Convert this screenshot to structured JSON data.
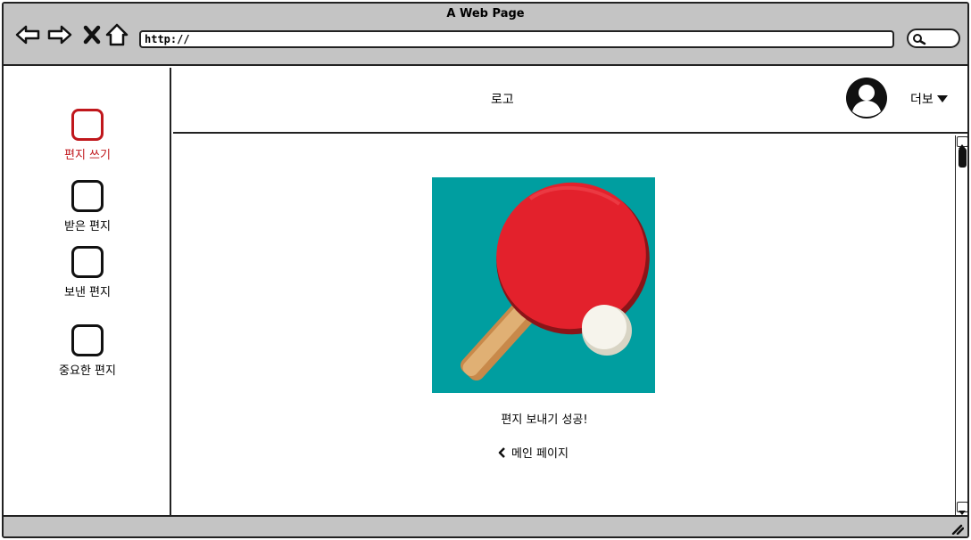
{
  "window": {
    "title": "A Web Page"
  },
  "toolbar": {
    "url": "http://",
    "back_icon": "back-arrow-icon",
    "forward_icon": "forward-arrow-icon",
    "close_icon": "close-x-icon",
    "home_icon": "home-icon",
    "search_icon": "search-icon"
  },
  "sidebar": {
    "items": [
      {
        "label": "편지 쓰기",
        "active": true
      },
      {
        "label": "받은 편지",
        "active": false
      },
      {
        "label": "보낸 편지",
        "active": false
      },
      {
        "label": "중요한 편지",
        "active": false
      }
    ]
  },
  "header": {
    "logo": "로고",
    "more_label": "더보",
    "avatar_icon": "user-avatar-icon",
    "dropdown_icon": "caret-down-icon"
  },
  "main": {
    "image_icon": "ping-pong-paddle-image",
    "success_message": "편지 보내기 성공!",
    "home_link": "메인 페이지",
    "home_link_icon": "chevron-left-icon"
  },
  "colors": {
    "accent": "#c0171c",
    "image_bg": "#009ea0",
    "paddle": "#e3212c",
    "handle": "#e0b074",
    "chrome": "#c4c4c4"
  }
}
